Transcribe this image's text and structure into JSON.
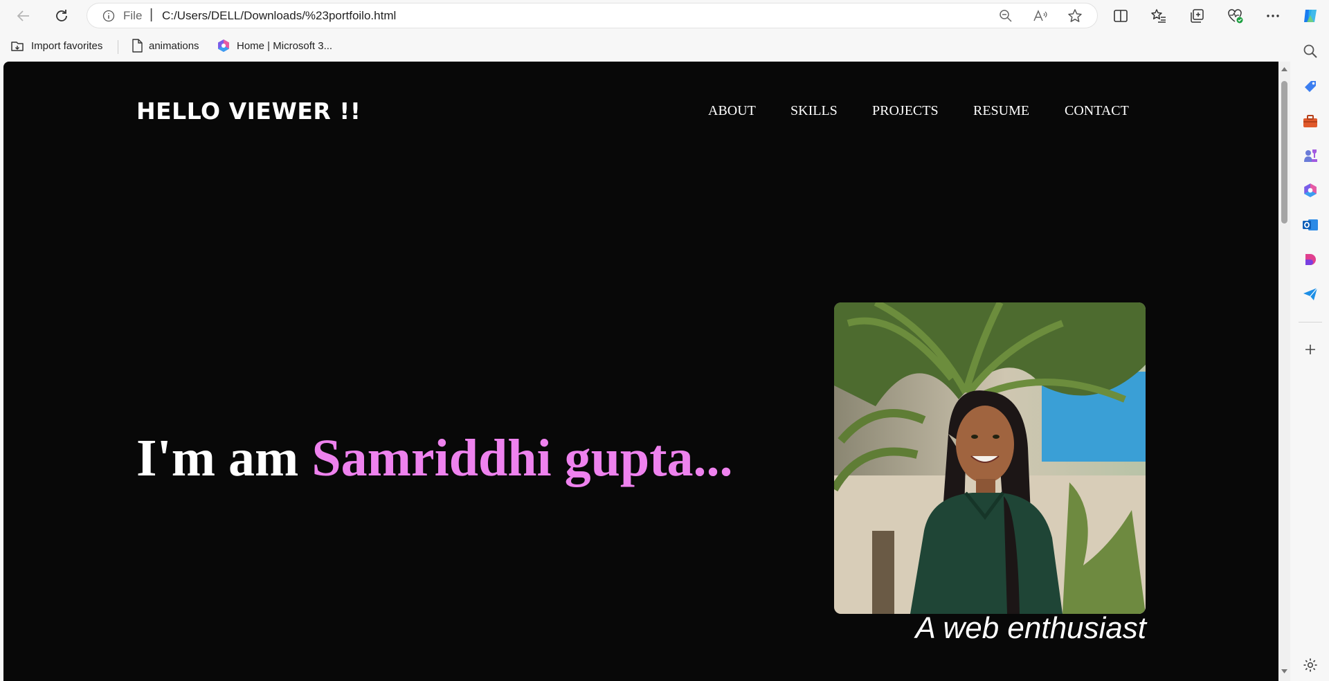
{
  "browser": {
    "address": {
      "protocol_label": "File",
      "separator": "|",
      "url": "C:/Users/DELL/Downloads/%23portfoilo.html"
    },
    "favorites": [
      {
        "label": "Import favorites"
      },
      {
        "label": "animations"
      },
      {
        "label": "Home | Microsoft 3..."
      }
    ]
  },
  "page": {
    "logo": "HELLO VIEWER !!",
    "nav": [
      "ABOUT",
      "SKILLS",
      "PROJECTS",
      "RESUME",
      "CONTACT"
    ],
    "hero_prefix": "I'm am ",
    "hero_name": "Samriddhi gupta...",
    "tagline": "A web enthusiast"
  },
  "colors": {
    "page_background": "#080808",
    "name_highlight": "#ee82ee",
    "text": "#ffffff"
  }
}
